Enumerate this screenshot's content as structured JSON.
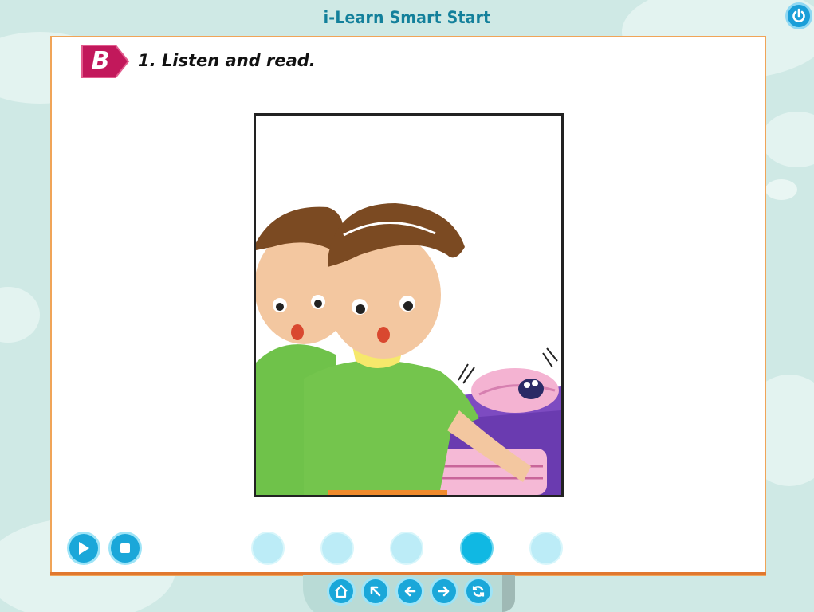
{
  "app": {
    "title": "i-Learn Smart Start"
  },
  "header": {
    "power_icon": "power-icon"
  },
  "section": {
    "badge_letter": "B",
    "instruction": "1. Listen and read."
  },
  "player": {
    "play_icon": "play-icon",
    "stop_icon": "stop-icon"
  },
  "pagination": {
    "total": 5,
    "active_index": 3
  },
  "nav": {
    "icons": [
      "home-icon",
      "back-arrow-icon",
      "previous-icon",
      "next-icon",
      "refresh-icon"
    ]
  },
  "colors": {
    "accent": "#1aa7d9",
    "title": "#13809b",
    "badge": "#c2185b",
    "panel_border": "#f0a458"
  }
}
